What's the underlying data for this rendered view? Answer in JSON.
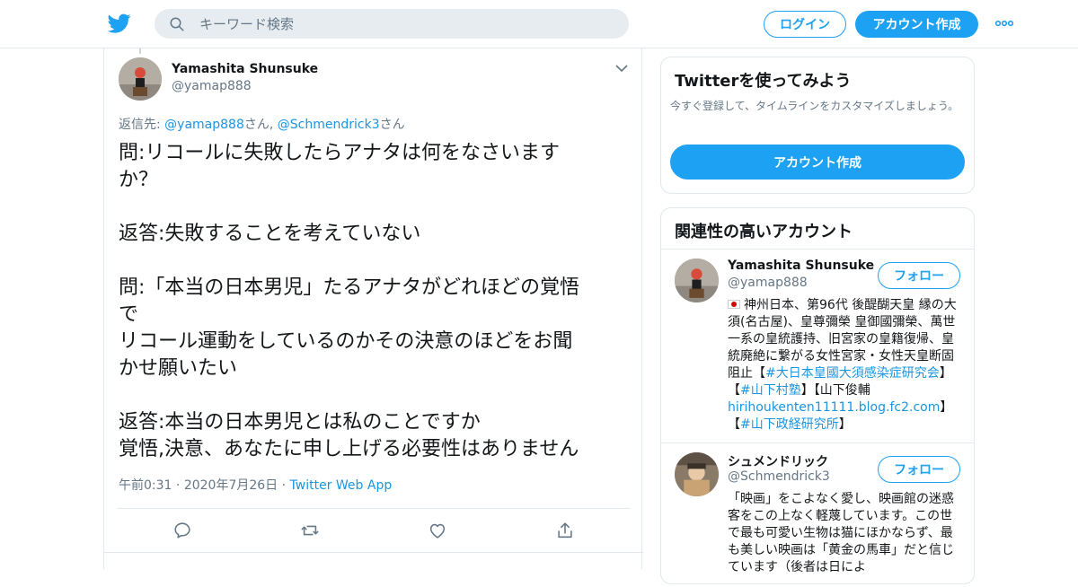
{
  "header": {
    "search_placeholder": "キーワード検索",
    "login_label": "ログイン",
    "signup_label": "アカウント作成"
  },
  "tweet": {
    "author_name": "Yamashita Shunsuke",
    "author_handle": "@yamap888",
    "reply_prefix": "返信先: ",
    "reply_user1": "@yamap888",
    "reply_suffix1": "さん, ",
    "reply_user2": "@Schmendrick3",
    "reply_suffix2": "さん",
    "text": "問:リコールに失敗したらアナタは何をなさいます\nか？\n\n返答:失敗することを考えていない\n\n問:「本当の日本男児」たるアナタがどれほどの覚悟\nで\nリコール運動をしているのかその決意のほどをお聞\nかせ願いたい\n\n返答:本当の日本男児とは私のことですか\n覚悟,決意、あなたに申し上げる必要性はありません",
    "time": "午前0:31",
    "date": "2020年7月26日",
    "dot": "·",
    "source": "Twitter Web App"
  },
  "sidebar": {
    "try_title": "Twitterを使ってみよう",
    "try_desc": "今すぐ登録して、タイムラインをカスタマイズしましょう。",
    "try_button": "アカウント作成",
    "related_title": "関連性の高いアカウント",
    "accounts": [
      {
        "name": "Yamashita Shunsuke",
        "handle": "@yamap888",
        "follow": "フォロー",
        "bio_a": "神州日本、第96代 後醍醐天皇 縁の大須(名古屋)、皇尊彌榮 皇御國彌榮、萬世一系の皇統護持、旧宮家の皇籍復帰、皇統廃絶に繋がる女性宮家・女性天皇断固阻止【",
        "bio_l1": "#大日本皇國大須感染症研究会",
        "bio_b": "】【",
        "bio_l2": "#山下村塾",
        "bio_c": "】【山下俊輔",
        "bio_l3": "hirihoukenten11111.blog.fc2.com",
        "bio_d": "】【",
        "bio_l4": "#山下政経研究所",
        "bio_e": "】"
      },
      {
        "name": "シュメンドリック",
        "handle": "@Schmendrick3",
        "follow": "フォロー",
        "bio": "「映画」をこよなく愛し、映画館の迷惑客をこの上なく軽蔑しています。この世で最も可愛い生物は猫にほかならず、最も美しい映画は「黄金の馬車」だと信じています（後者は日によ"
      }
    ]
  },
  "colors": {
    "brand": "#1da1f2",
    "link": "#1b95e0",
    "muted": "#657786",
    "border": "#e1e8ed"
  },
  "icons": [
    "twitter-bird-icon",
    "search-icon",
    "more-icon",
    "chevron-down-icon",
    "reply-icon",
    "retweet-icon",
    "like-icon",
    "share-icon",
    "japan-flag-icon"
  ]
}
